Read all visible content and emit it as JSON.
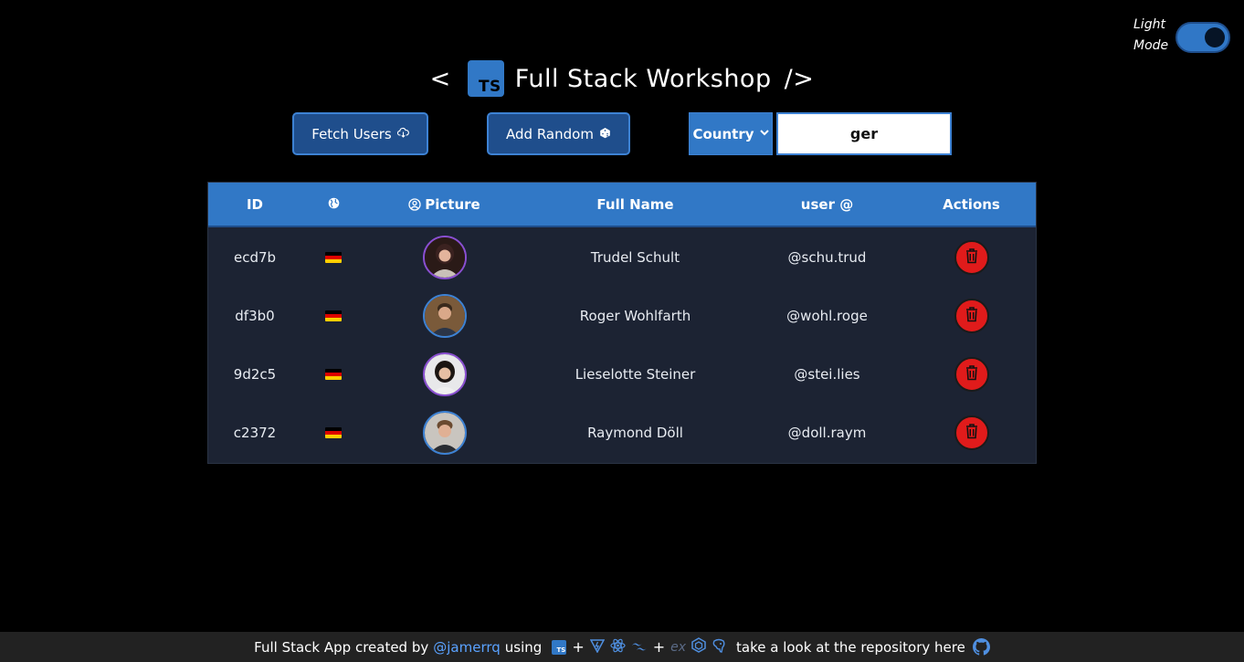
{
  "theme_toggle": {
    "label": "Light\nMode",
    "label_line1": "Light",
    "label_line2": "Mode",
    "checked": true
  },
  "header": {
    "open_bracket": "<",
    "logo_text": "TS",
    "title": "Full Stack Workshop",
    "close_bracket": "/>"
  },
  "controls": {
    "fetch_label": "Fetch Users",
    "random_label": "Add Random",
    "country_selected": "Country",
    "search_value": "ger"
  },
  "table": {
    "headers": {
      "id": "ID",
      "flag": "",
      "picture": "Picture",
      "name": "Full Name",
      "user": "user @",
      "actions": "Actions"
    },
    "rows": [
      {
        "id": "ecd7b",
        "name": "Trudel Schult",
        "user": "@schu.trud"
      },
      {
        "id": "df3b0",
        "name": "Roger Wohlfarth",
        "user": "@wohl.roge"
      },
      {
        "id": "9d2c5",
        "name": "Lieselotte Steiner",
        "user": "@stei.lies"
      },
      {
        "id": "c2372",
        "name": "Raymond Döll",
        "user": "@doll.raym"
      }
    ]
  },
  "footer": {
    "prefix": "Full Stack App created by",
    "author": "@jamerrq",
    "using": "using",
    "ex": "ex",
    "suffix": "take a look at the repository here"
  },
  "colors": {
    "accent": "#3178c6",
    "danger": "#e01b1b",
    "table_bg": "#1c2333",
    "link": "#5aa2ff"
  }
}
